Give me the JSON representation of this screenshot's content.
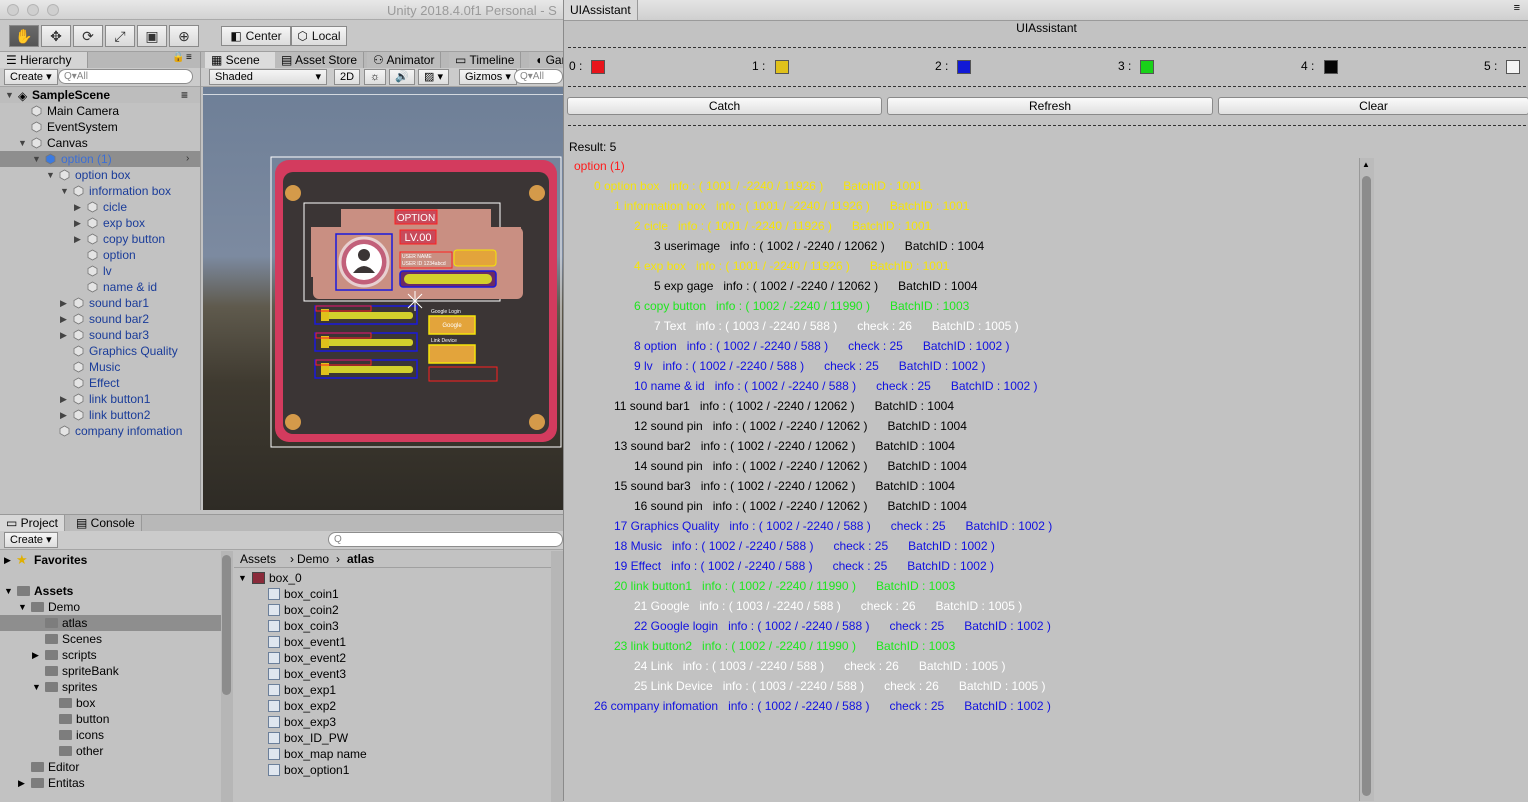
{
  "titlebar": {
    "title": "Unity 2018.4.0f1 Personal - S"
  },
  "toolbar": {
    "center_label": "Center",
    "local_label": "Local"
  },
  "hierarchy": {
    "tab": "Hierarchy",
    "create": "Create",
    "search_placeholder": "Q▾All",
    "scene": "SampleScene",
    "rows": [
      {
        "label": "Main Camera",
        "depth": 1,
        "arrow": "",
        "blue": false
      },
      {
        "label": "EventSystem",
        "depth": 1,
        "arrow": "",
        "blue": false
      },
      {
        "label": "Canvas",
        "depth": 1,
        "arrow": "▼",
        "blue": false
      },
      {
        "label": "option (1)",
        "depth": 2,
        "arrow": "▼",
        "blue": true,
        "selected": true
      },
      {
        "label": "option box",
        "depth": 3,
        "arrow": "▼",
        "blue": true
      },
      {
        "label": "information box",
        "depth": 4,
        "arrow": "▼",
        "blue": true
      },
      {
        "label": "cicle",
        "depth": 5,
        "arrow": "▶",
        "blue": true
      },
      {
        "label": "exp box",
        "depth": 5,
        "arrow": "▶",
        "blue": true
      },
      {
        "label": "copy button",
        "depth": 5,
        "arrow": "▶",
        "blue": true
      },
      {
        "label": "option",
        "depth": 5,
        "arrow": "",
        "blue": true
      },
      {
        "label": "lv",
        "depth": 5,
        "arrow": "",
        "blue": true
      },
      {
        "label": "name & id",
        "depth": 5,
        "arrow": "",
        "blue": true
      },
      {
        "label": "sound bar1",
        "depth": 4,
        "arrow": "▶",
        "blue": true
      },
      {
        "label": "sound bar2",
        "depth": 4,
        "arrow": "▶",
        "blue": true
      },
      {
        "label": "sound bar3",
        "depth": 4,
        "arrow": "▶",
        "blue": true
      },
      {
        "label": "Graphics Quality",
        "depth": 4,
        "arrow": "",
        "blue": true
      },
      {
        "label": "Music",
        "depth": 4,
        "arrow": "",
        "blue": true
      },
      {
        "label": "Effect",
        "depth": 4,
        "arrow": "",
        "blue": true
      },
      {
        "label": "link button1",
        "depth": 4,
        "arrow": "▶",
        "blue": true
      },
      {
        "label": "link button2",
        "depth": 4,
        "arrow": "▶",
        "blue": true
      },
      {
        "label": "company infomation",
        "depth": 3,
        "arrow": "",
        "blue": true
      }
    ]
  },
  "scene": {
    "tabs": [
      "Scene",
      "Asset Store",
      "Animator",
      "Timeline",
      "Gar"
    ],
    "shading": "Shaded",
    "mode_2d": "2D",
    "gizmos": "Gizmos",
    "search": "Q▾All",
    "option_title": "OPTION",
    "level": "LV.00",
    "user_name": "USER NAME",
    "user_id": "USER ID 1234abcd",
    "google_login": "Google Login",
    "google": "Google",
    "link_device": "Link Device"
  },
  "project": {
    "tabs": [
      "Project",
      "Console"
    ],
    "create": "Create",
    "breadcrumb": [
      "Assets",
      "Demo",
      "atlas"
    ],
    "left_rows": [
      {
        "label": "Favorites",
        "indent": 0,
        "arrow": "▶",
        "bold": true,
        "star": true
      },
      {
        "label": "Assets",
        "indent": 0,
        "arrow": "▼",
        "bold": true
      },
      {
        "label": "Demo",
        "indent": 1,
        "arrow": "▼"
      },
      {
        "label": "atlas",
        "indent": 2,
        "arrow": "",
        "selected": true
      },
      {
        "label": "Scenes",
        "indent": 2,
        "arrow": ""
      },
      {
        "label": "scripts",
        "indent": 2,
        "arrow": "▶"
      },
      {
        "label": "spriteBank",
        "indent": 2,
        "arrow": ""
      },
      {
        "label": "sprites",
        "indent": 2,
        "arrow": "▼"
      },
      {
        "label": "box",
        "indent": 3,
        "arrow": ""
      },
      {
        "label": "button",
        "indent": 3,
        "arrow": ""
      },
      {
        "label": "icons",
        "indent": 3,
        "arrow": ""
      },
      {
        "label": "other",
        "indent": 3,
        "arrow": ""
      },
      {
        "label": "Editor",
        "indent": 1,
        "arrow": ""
      },
      {
        "label": "Entitas",
        "indent": 1,
        "arrow": "▶"
      }
    ],
    "atlas_root": "box_0",
    "atlas_items": [
      "box_coin1",
      "box_coin2",
      "box_coin3",
      "box_event1",
      "box_event2",
      "box_event3",
      "box_exp1",
      "box_exp2",
      "box_exp3",
      "box_ID_PW",
      "box_map name",
      "box_option1"
    ]
  },
  "assistant": {
    "tab": "UIAssistant",
    "header": "UIAssistant",
    "swatches": [
      {
        "label": "0 :",
        "color": "#e8141b"
      },
      {
        "label": "1 :",
        "color": "#e0c11b"
      },
      {
        "label": "2 :",
        "color": "#1119d6"
      },
      {
        "label": "3 :",
        "color": "#19d219"
      },
      {
        "label": "4 :",
        "color": "#050505"
      },
      {
        "label": "5 :",
        "color": "#f4f4f4"
      }
    ],
    "buttons": [
      "Catch",
      "Refresh",
      "Clear"
    ],
    "result": "Result: 5",
    "lines": [
      {
        "text": "option (1)",
        "indent": 0,
        "color": "#ff1a1a"
      },
      {
        "text": "0 option box   info : ( 1001 / -2240 / 11926 )      BatchID : 1001",
        "indent": 1,
        "color": "#f5e40a"
      },
      {
        "text": "1 information box   info : ( 1001 / -2240 / 11926 )      BatchID : 1001",
        "indent": 2,
        "color": "#f5e40a"
      },
      {
        "text": "2 cicle   info : ( 1001 / -2240 / 11926 )      BatchID : 1001",
        "indent": 3,
        "color": "#f5e40a"
      },
      {
        "text": "3 userimage   info : ( 1002 / -2240 / 12062 )      BatchID : 1004",
        "indent": 4,
        "color": "#000000"
      },
      {
        "text": "4 exp box   info : ( 1001 / -2240 / 11926 )      BatchID : 1001",
        "indent": 3,
        "color": "#f5e40a"
      },
      {
        "text": "5 exp gage   info : ( 1002 / -2240 / 12062 )      BatchID : 1004",
        "indent": 4,
        "color": "#000000"
      },
      {
        "text": "6 copy button   info : ( 1002 / -2240 / 11990 )      BatchID : 1003",
        "indent": 3,
        "color": "#1ee61e"
      },
      {
        "text": "7 Text   info : ( 1003 / -2240 / 588 )      check : 26      BatchID : 1005 )",
        "indent": 4,
        "color": "#ffffff"
      },
      {
        "text": "8 option   info : ( 1002 / -2240 / 588 )      check : 25      BatchID : 1002 )",
        "indent": 3,
        "color": "#1111e0"
      },
      {
        "text": "9 lv   info : ( 1002 / -2240 / 588 )      check : 25      BatchID : 1002 )",
        "indent": 3,
        "color": "#1111e0"
      },
      {
        "text": "10 name & id   info : ( 1002 / -2240 / 588 )      check : 25      BatchID : 1002 )",
        "indent": 3,
        "color": "#1111e0"
      },
      {
        "text": "11 sound bar1   info : ( 1002 / -2240 / 12062 )      BatchID : 1004",
        "indent": 2,
        "color": "#000000"
      },
      {
        "text": "12 sound pin   info : ( 1002 / -2240 / 12062 )      BatchID : 1004",
        "indent": 3,
        "color": "#000000"
      },
      {
        "text": "13 sound bar2   info : ( 1002 / -2240 / 12062 )      BatchID : 1004",
        "indent": 2,
        "color": "#000000"
      },
      {
        "text": "14 sound pin   info : ( 1002 / -2240 / 12062 )      BatchID : 1004",
        "indent": 3,
        "color": "#000000"
      },
      {
        "text": "15 sound bar3   info : ( 1002 / -2240 / 12062 )      BatchID : 1004",
        "indent": 2,
        "color": "#000000"
      },
      {
        "text": "16 sound pin   info : ( 1002 / -2240 / 12062 )      BatchID : 1004",
        "indent": 3,
        "color": "#000000"
      },
      {
        "text": "17 Graphics Quality   info : ( 1002 / -2240 / 588 )      check : 25      BatchID : 1002 )",
        "indent": 2,
        "color": "#1111e0"
      },
      {
        "text": "18 Music   info : ( 1002 / -2240 / 588 )      check : 25      BatchID : 1002 )",
        "indent": 2,
        "color": "#1111e0"
      },
      {
        "text": "19 Effect   info : ( 1002 / -2240 / 588 )      check : 25      BatchID : 1002 )",
        "indent": 2,
        "color": "#1111e0"
      },
      {
        "text": "20 link button1   info : ( 1002 / -2240 / 11990 )      BatchID : 1003",
        "indent": 2,
        "color": "#1ee61e"
      },
      {
        "text": "21 Google   info : ( 1003 / -2240 / 588 )      check : 26      BatchID : 1005 )",
        "indent": 3,
        "color": "#ffffff"
      },
      {
        "text": "22 Google login   info : ( 1002 / -2240 / 588 )      check : 25      BatchID : 1002 )",
        "indent": 3,
        "color": "#1111e0"
      },
      {
        "text": "23 link button2   info : ( 1002 / -2240 / 11990 )      BatchID : 1003",
        "indent": 2,
        "color": "#1ee61e"
      },
      {
        "text": "24 Link   info : ( 1003 / -2240 / 588 )      check : 26      BatchID : 1005 )",
        "indent": 3,
        "color": "#ffffff"
      },
      {
        "text": "25 Link Device   info : ( 1003 / -2240 / 588 )      check : 26      BatchID : 1005 )",
        "indent": 3,
        "color": "#ffffff"
      },
      {
        "text": "26 company infomation   info : ( 1002 / -2240 / 588 )      check : 25      BatchID : 1002 )",
        "indent": 1,
        "color": "#1111e0"
      }
    ]
  }
}
